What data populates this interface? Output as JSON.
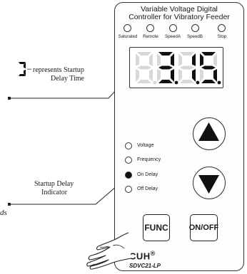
{
  "panel": {
    "title_line1": "Variable Voltage Digital",
    "title_line2": "Controller for Vibratory Feeder",
    "indicators": [
      {
        "label": "Saturated"
      },
      {
        "label": "Remote"
      },
      {
        "label": "SpeedA"
      },
      {
        "label": "SpeedB"
      },
      {
        "label": "Stop"
      }
    ],
    "display_value": "3.1.5.",
    "modes": [
      {
        "label": "Voltage",
        "active": false
      },
      {
        "label": "Frequency",
        "active": false
      },
      {
        "label": "On Delay",
        "active": true
      },
      {
        "label": "Off Delay",
        "active": false
      }
    ],
    "func_label": "FUNC",
    "onoff_label": "ON/OFF",
    "brand": "CUH",
    "registered_mark": "®",
    "model": "SDVC21-LP"
  },
  "callouts": {
    "startup_delay_time_line1": "represents Startup",
    "startup_delay_time_line2": "Delay Time",
    "startup_delay_indicator_line1": "Startup Delay",
    "startup_delay_indicator_line2": "Indicator",
    "partial_text": "ds"
  },
  "colors": {
    "outline": "#333333",
    "segment_on": "#111111",
    "segment_off": "#d8d8d8",
    "active_indicator": "#111111"
  }
}
